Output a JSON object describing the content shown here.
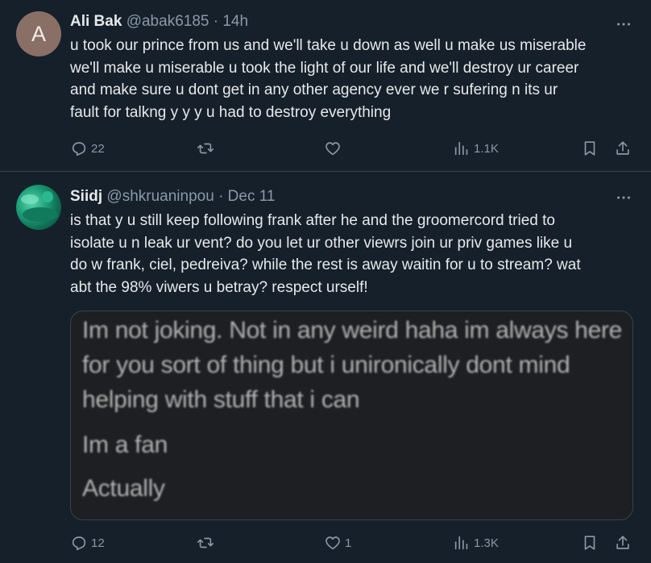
{
  "tweets": [
    {
      "name": "Ali Bak",
      "handle": "@abak6185",
      "sep": "·",
      "time": "14h",
      "avatar_letter": "A",
      "text_lines": [
        "u took our prince from us and we'll take u down as well u make us miserable",
        "we'll make u miserable u took the light of our life and we'll destroy ur career",
        "and make sure u dont get in any other agency ever we r sufering n its ur",
        "fault for talkng y y y u had to destroy everything"
      ],
      "stats": {
        "replies": "22",
        "reposts": "",
        "likes": "",
        "views": "1.1K"
      }
    },
    {
      "name": "Siidj",
      "handle": "@shkruaninpou",
      "sep": "·",
      "time": "Dec 11",
      "text_lines": [
        "is that y u still keep following frank after he and the groomercord tried to",
        "isolate u n leak ur vent? do you let ur other viewrs join ur priv games like u",
        "do w frank, ciel, pedreiva? while the rest is away waitin for u to stream? wat",
        "abt the 98% viwers u betray? respect urself!"
      ],
      "media_lines": [
        "Im not joking. Not in any weird haha im always here",
        "for you sort of thing but i unironically dont mind",
        "helping with stuff that i can",
        "Im a fan",
        "Actually"
      ],
      "stats": {
        "replies": "12",
        "reposts": "",
        "likes": "1",
        "views": "1.3K"
      }
    }
  ],
  "icons": [
    "reply-icon",
    "repost-icon",
    "like-icon",
    "views-icon",
    "bookmark-icon",
    "share-icon",
    "more-icon"
  ],
  "colors": {
    "background": "#15202b",
    "text": "#e7e9ea",
    "secondary": "#8b98a5",
    "border": "#38444d"
  }
}
